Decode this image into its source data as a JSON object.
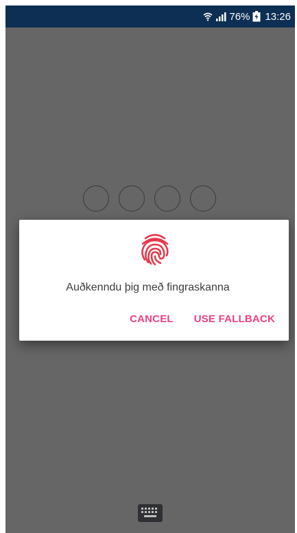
{
  "status_bar": {
    "battery": "76%",
    "time": "13:26",
    "icons": [
      "wifi-icon",
      "signal-icon",
      "battery-icon"
    ],
    "background": "#0e2f54"
  },
  "lock_screen": {
    "pin_length": 4,
    "background": "#666666"
  },
  "dialog": {
    "icon": "fingerprint-icon",
    "icon_color": "#e6394b",
    "message": "Auðkenndu þig með fingraskanna",
    "cancel_label": "CANCEL",
    "fallback_label": "USE FALLBACK",
    "accent_color": "#ef3f84"
  },
  "bottom": {
    "icon": "keyboard-icon"
  }
}
